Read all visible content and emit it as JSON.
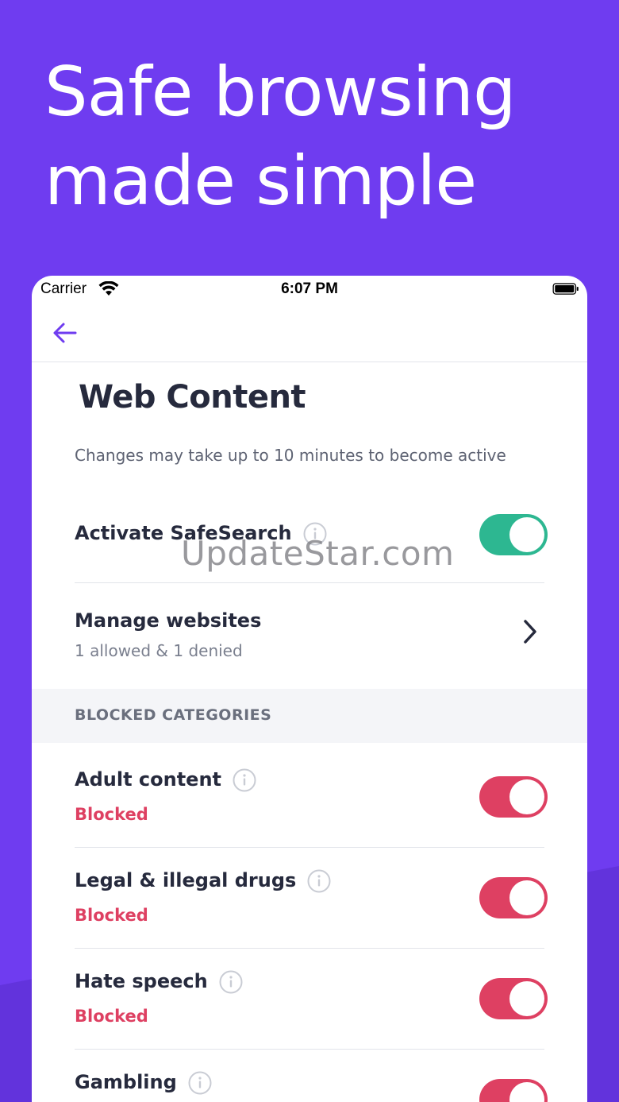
{
  "headline": {
    "line1": "Safe browsing",
    "line2": "made simple"
  },
  "status_bar": {
    "carrier": "Carrier",
    "time": "6:07 PM"
  },
  "nav": {
    "back_icon": "arrow-left-icon"
  },
  "page": {
    "title": "Web Content",
    "subtitle": "Changes may take up to 10 minutes to become active"
  },
  "safesearch": {
    "label": "Activate SafeSearch",
    "enabled": true
  },
  "manage_websites": {
    "label": "Manage websites",
    "summary": "1 allowed & 1 denied"
  },
  "blocked_section": {
    "header": "BLOCKED CATEGORIES",
    "items": [
      {
        "label": "Adult content",
        "status": "Blocked",
        "enabled": true
      },
      {
        "label": "Legal & illegal drugs",
        "status": "Blocked",
        "enabled": true
      },
      {
        "label": "Hate speech",
        "status": "Blocked",
        "enabled": true
      },
      {
        "label": "Gambling",
        "status": "",
        "enabled": true
      }
    ]
  },
  "watermark": "UpdateStar.com",
  "colors": {
    "background": "#6f3cf0",
    "accent": "#6f3cf0",
    "toggle_on_green": "#2db791",
    "toggle_on_red": "#de4062",
    "blocked_text": "#de4062"
  }
}
